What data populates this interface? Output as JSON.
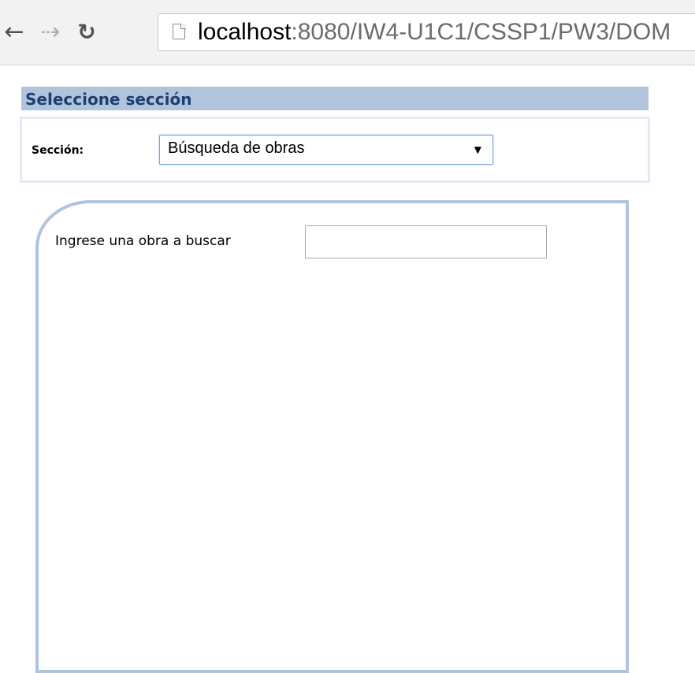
{
  "browser": {
    "back_icon": "arrow-left-icon",
    "forward_icon": "arrow-right-icon",
    "reload_icon": "reload-icon",
    "url_host": "localhost",
    "url_path": ":8080/IW4-U1C1/CSSP1/PW3/DOM"
  },
  "page": {
    "section_header": "Seleccione sección",
    "section_label": "Sección:",
    "section_select_value": "Búsqueda de obras",
    "search_label": "Ingrese una obra a buscar",
    "search_value": "",
    "search_placeholder": ""
  },
  "colors": {
    "header_bg": "#b0c4de",
    "header_text": "#1f3d6e",
    "panel_border": "#b0c4de",
    "box_border": "#e3eaf5",
    "select_border": "#7ea4d7"
  }
}
